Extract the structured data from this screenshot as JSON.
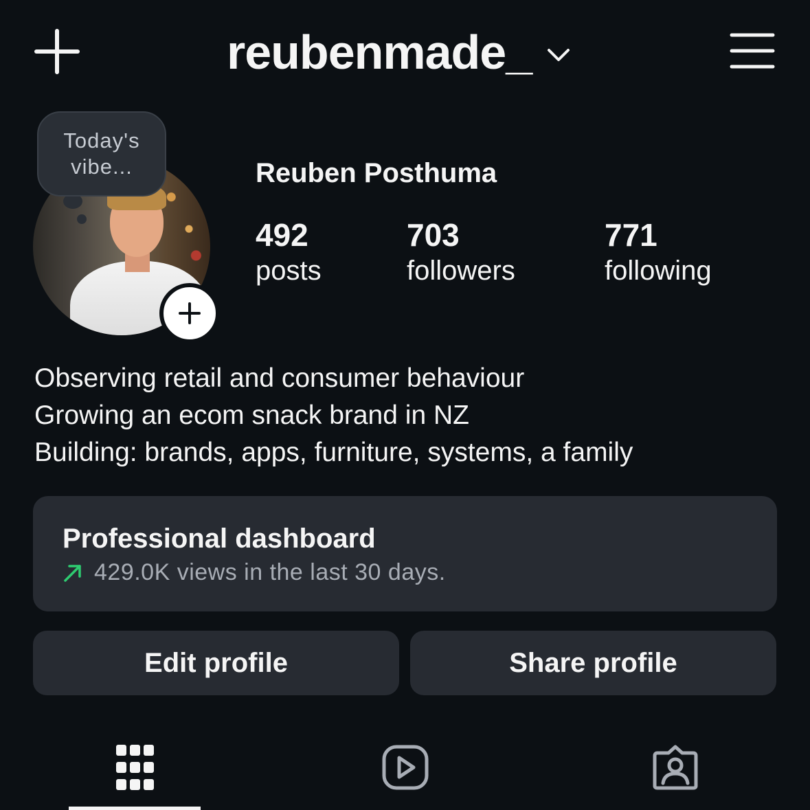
{
  "header": {
    "username": "reubenmade_",
    "new_post_icon": "plus-icon",
    "switch_account_icon": "chevron-down-icon",
    "menu_icon": "hamburger-menu-icon"
  },
  "profile": {
    "note_bubble": "Today's vibe...",
    "add_story_icon": "plus-icon",
    "full_name": "Reuben Posthuma",
    "stats": {
      "posts": {
        "value": "492",
        "label": "posts"
      },
      "followers": {
        "value": "703",
        "label": "followers"
      },
      "following": {
        "value": "771",
        "label": "following"
      }
    },
    "bio": [
      "Observing retail and consumer behaviour",
      "Growing an ecom snack brand in NZ",
      "Building: brands, apps, furniture, systems, a family"
    ]
  },
  "dashboard": {
    "title": "Professional dashboard",
    "subtitle": "429.0K views in the last 30 days.",
    "trend_icon": "arrow-up-right-icon",
    "trend_color": "#2ecc71"
  },
  "actions": {
    "edit_label": "Edit profile",
    "share_label": "Share profile"
  },
  "tabs": [
    {
      "icon": "grid-icon",
      "active": true
    },
    {
      "icon": "reels-icon",
      "active": false
    },
    {
      "icon": "tagged-icon",
      "active": false
    }
  ],
  "colors": {
    "background": "#0c1014",
    "surface": "#272b32",
    "text": "#f5f5f5",
    "muted": "#a8adb5"
  }
}
